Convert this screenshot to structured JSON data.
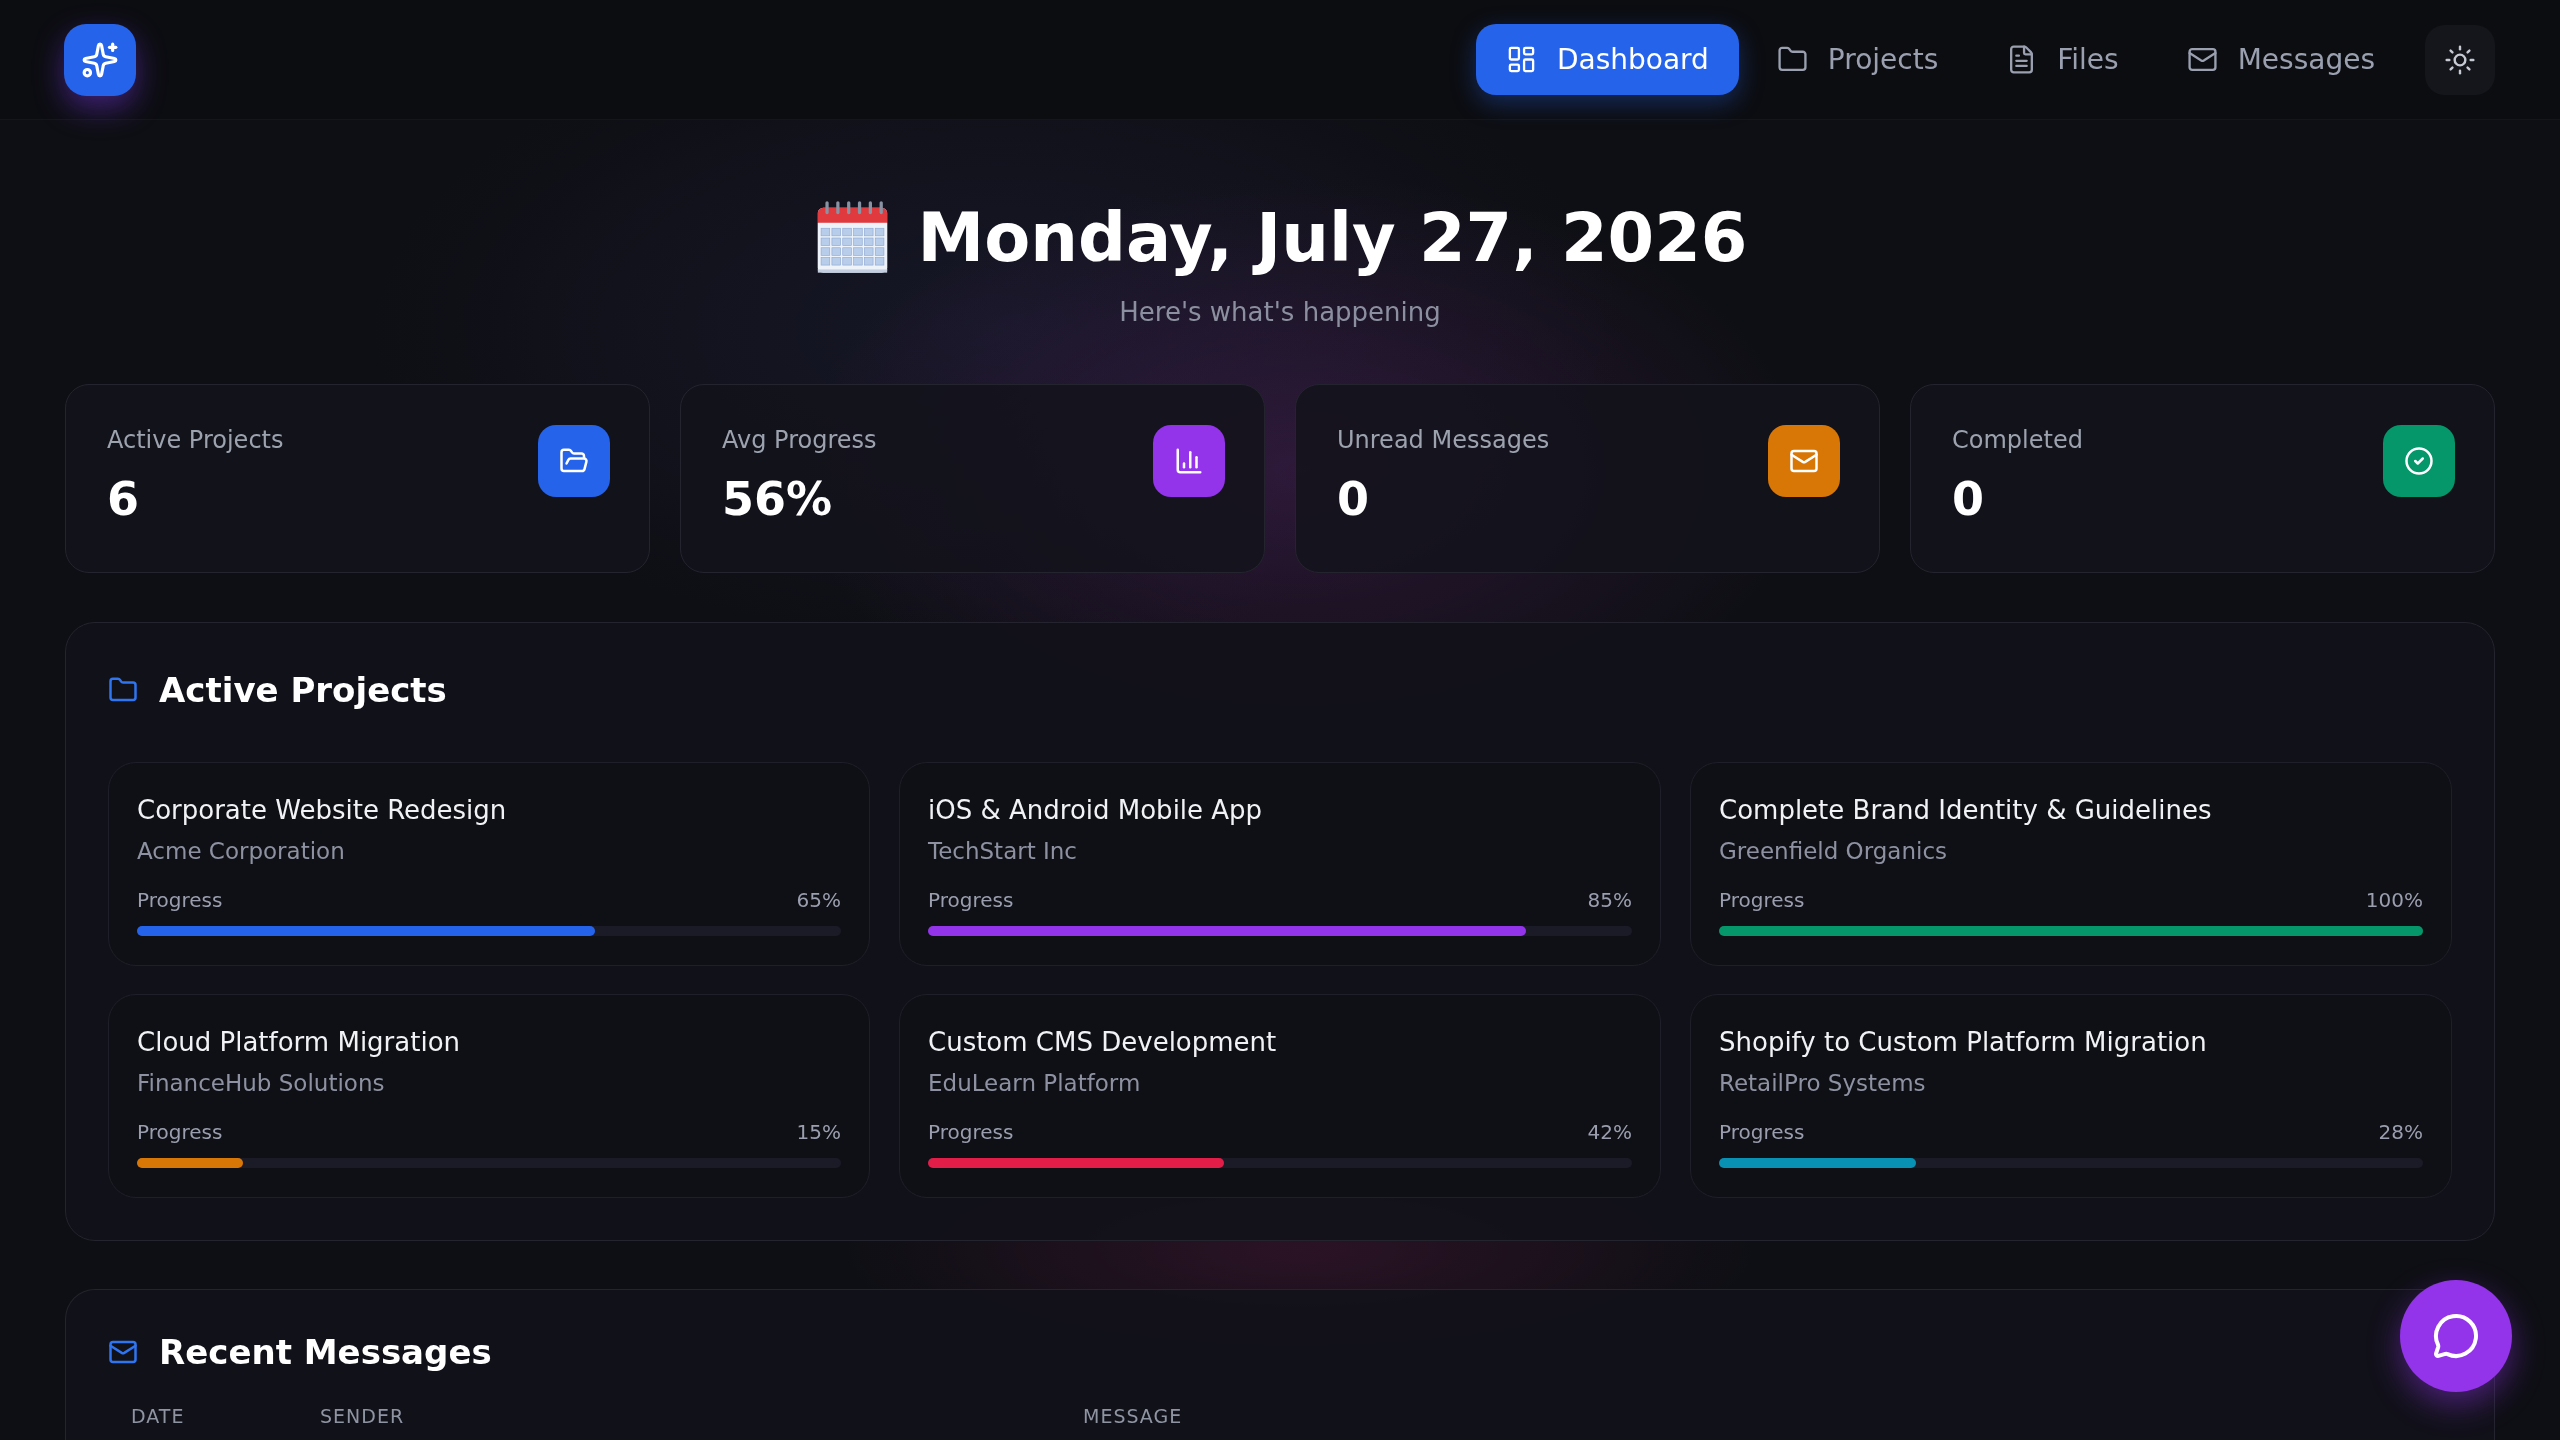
{
  "nav": {
    "items": [
      {
        "label": "Dashboard",
        "selected": true
      },
      {
        "label": "Projects",
        "selected": false
      },
      {
        "label": "Files",
        "selected": false
      },
      {
        "label": "Messages",
        "selected": false
      }
    ]
  },
  "hero": {
    "title": "Monday, July 27, 2026",
    "subtitle": "Here's what's happening"
  },
  "stats": [
    {
      "label": "Active Projects",
      "value": "6",
      "color": "#2563eb"
    },
    {
      "label": "Avg Progress",
      "value": "56%",
      "color": "#9333ea"
    },
    {
      "label": "Unread Messages",
      "value": "0",
      "color": "#d97706"
    },
    {
      "label": "Completed",
      "value": "0",
      "color": "#059669"
    }
  ],
  "active_projects": {
    "title": "Active Projects",
    "items": [
      {
        "name": "Corporate Website Redesign",
        "client": "Acme Corporation",
        "progress_label": "Progress",
        "percent": "65%",
        "level": 0.65,
        "color": "#2563eb"
      },
      {
        "name": "iOS & Android Mobile App",
        "client": "TechStart Inc",
        "progress_label": "Progress",
        "percent": "85%",
        "level": 0.85,
        "color": "#9333ea"
      },
      {
        "name": "Complete Brand Identity & Guidelines",
        "client": "Greenfield Organics",
        "progress_label": "Progress",
        "percent": "100%",
        "level": 1.0,
        "color": "#059669"
      },
      {
        "name": "Cloud Platform Migration",
        "client": "FinanceHub Solutions",
        "progress_label": "Progress",
        "percent": "15%",
        "level": 0.15,
        "color": "#d97706"
      },
      {
        "name": "Custom CMS Development",
        "client": "EduLearn Platform",
        "progress_label": "Progress",
        "percent": "42%",
        "level": 0.42,
        "color": "#e11d48"
      },
      {
        "name": "Shopify to Custom Platform Migration",
        "client": "RetailPro Systems",
        "progress_label": "Progress",
        "percent": "28%",
        "level": 0.28,
        "color": "#0891b2"
      }
    ]
  },
  "recent_messages": {
    "title": "Recent Messages",
    "columns": [
      "DATE",
      "SENDER",
      "MESSAGE"
    ]
  }
}
